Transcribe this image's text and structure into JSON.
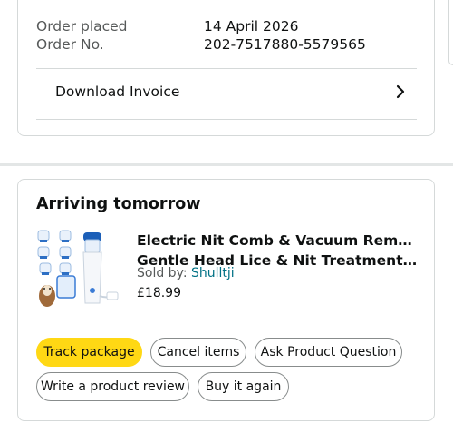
{
  "order_info": {
    "placed_label": "Order placed",
    "placed_value": "14 April 2026",
    "number_label": "Order No.",
    "number_value": "202-7517880-5579565",
    "download_invoice": "Download Invoice"
  },
  "shipment": {
    "status": "Arriving tomorrow",
    "product": {
      "title_line1": "Electric Nit Comb & Vacuum Remover,",
      "title_line2": "Gentle Head Lice & Nit Treatment for Ki...",
      "sold_by_label": "Sold by:",
      "seller": "Shulltji",
      "price": "£18.99"
    },
    "buttons": {
      "track": "Track package",
      "cancel": "Cancel items",
      "ask": "Ask Product Question",
      "review": "Write a product review",
      "buy_again": "Buy it again"
    }
  },
  "colors": {
    "primary_button": "#ffd814",
    "seller_link": "#007185",
    "border": "#d5d9d9"
  }
}
